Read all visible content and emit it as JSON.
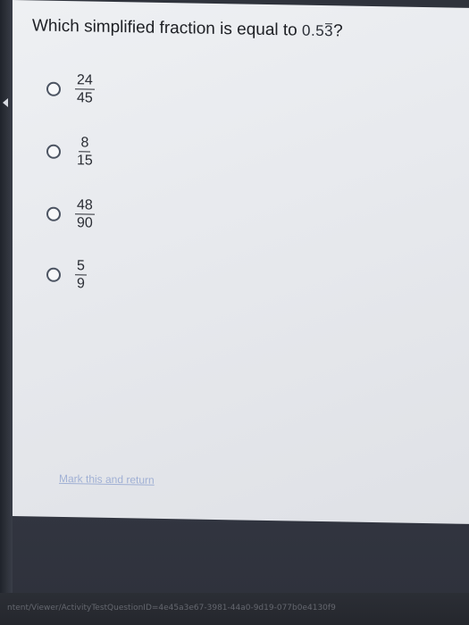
{
  "question": {
    "text": "Which simplified fraction is equal to",
    "value_prefix": "0.5",
    "value_repeat": "3",
    "suffix": "?"
  },
  "choices": [
    {
      "numerator": "24",
      "denominator": "45"
    },
    {
      "numerator": "8",
      "denominator": "15"
    },
    {
      "numerator": "48",
      "denominator": "90"
    },
    {
      "numerator": "5",
      "denominator": "9"
    }
  ],
  "mark_link": "Mark this and return",
  "status_url": "ntent/Viewer/ActivityTestQuestionID=4e45a3e67-3981-44a0-9d19-077b0e4130f9"
}
